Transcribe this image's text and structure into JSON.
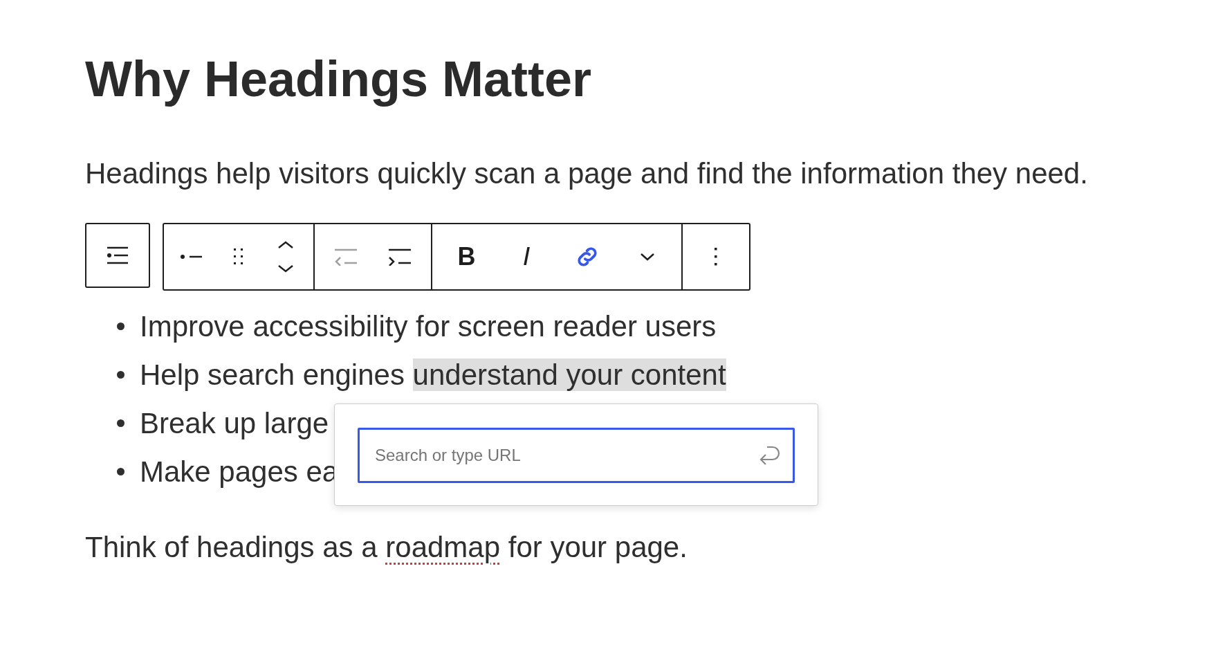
{
  "heading": "Why Headings Matter",
  "intro": "Headings help visitors quickly scan a page and find the information they need.",
  "toolbar": {
    "groups": [
      {
        "buttons": [
          {
            "kind": "list-bullet",
            "active": false
          },
          {
            "kind": "drag",
            "active": false
          },
          {
            "kind": "move",
            "active": false
          }
        ]
      },
      {
        "buttons": [
          {
            "kind": "outdent",
            "active": false,
            "disabled": true
          },
          {
            "kind": "indent",
            "active": false,
            "disabled": false
          }
        ]
      },
      {
        "buttons": [
          {
            "kind": "bold",
            "active": false,
            "label": "B"
          },
          {
            "kind": "italic",
            "active": false,
            "label": "I"
          },
          {
            "kind": "link",
            "active": true
          },
          {
            "kind": "more",
            "active": false
          }
        ]
      },
      {
        "buttons": [
          {
            "kind": "options",
            "active": false
          }
        ]
      }
    ]
  },
  "list": [
    {
      "text": "Improve accessibility for screen reader users"
    },
    {
      "text": "Help search engines ",
      "highlighted": "understand your content"
    },
    {
      "text": "Break up large"
    },
    {
      "text": "Make pages ea"
    }
  ],
  "link_popover": {
    "placeholder": "Search or type URL"
  },
  "closing": [
    {
      "text": "Think of headings as a ",
      "misspelled": false
    },
    {
      "text": "roadmap",
      "misspelled": true
    },
    {
      "text": " for your page.",
      "misspelled": false
    }
  ]
}
